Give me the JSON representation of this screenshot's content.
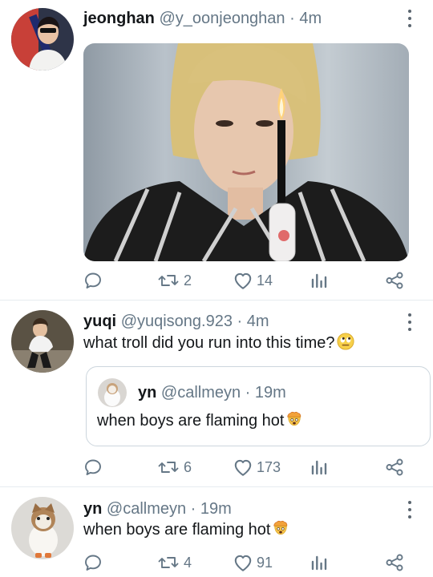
{
  "tweets": [
    {
      "name": "jeonghan",
      "handle": "@y_oonjeonghan",
      "time": " · 4m",
      "text": "",
      "actions": {
        "reply_count": "",
        "retweet_count": "2",
        "like_count": "14"
      }
    },
    {
      "name": "yuqi",
      "handle": "@yuqisong.923",
      "time": " · 4m",
      "text": "what troll did you run into this time?",
      "emoji": "rolling-eyes-emoji",
      "quote": {
        "name": "yn",
        "handle": "@callmeyn",
        "time": " · 19m",
        "text": "when boys are flaming hot",
        "emoji": "exploding-head-emoji"
      },
      "actions": {
        "reply_count": "",
        "retweet_count": "6",
        "like_count": "173"
      }
    },
    {
      "name": "yn",
      "handle": "@callmeyn",
      "time": " · 19m",
      "text": "when boys are flaming hot",
      "emoji": "exploding-head-emoji",
      "actions": {
        "reply_count": "",
        "retweet_count": "4",
        "like_count": "91"
      }
    }
  ],
  "colors": {
    "icon": "#657786",
    "text": "#14171a",
    "divider": "#e6ecf0"
  }
}
